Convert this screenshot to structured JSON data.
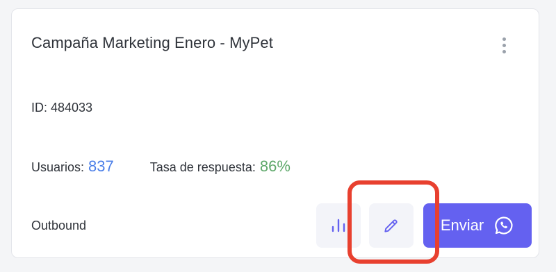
{
  "campaign": {
    "title": "Campaña Marketing Enero - MyPet",
    "id_text": "ID: 484033",
    "users_label": "Usuarios:",
    "users_value": "837",
    "response_label": "Tasa de respuesta:",
    "response_value": "86%",
    "type": "Outbound"
  },
  "actions": {
    "send_label": "Enviar",
    "stats_icon": "bar-chart-icon",
    "edit_icon": "pencil-icon",
    "send_icon": "whatsapp-icon"
  },
  "colors": {
    "users_value": "#4a7ee8",
    "response_value": "#5ea86a",
    "send_button": "#6461f0",
    "highlight": "#e8402f"
  }
}
